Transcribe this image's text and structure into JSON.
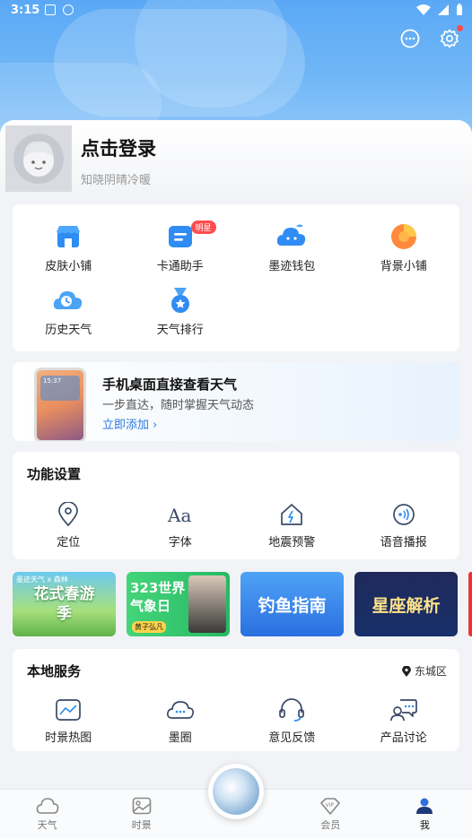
{
  "status_bar": {
    "time": "3:15"
  },
  "profile": {
    "title": "点击登录",
    "subtitle": "知晓阴晴冷暖"
  },
  "quick_grid": [
    {
      "label": "皮肤小铺",
      "icon": "shop-icon"
    },
    {
      "label": "卡通助手",
      "icon": "cartoon-assistant-icon",
      "badge": "明星"
    },
    {
      "label": "墨迹钱包",
      "icon": "wallet-icon"
    },
    {
      "label": "背景小铺",
      "icon": "background-shop-icon"
    },
    {
      "label": "历史天气",
      "icon": "history-weather-icon"
    },
    {
      "label": "天气排行",
      "icon": "ranking-medal-icon"
    }
  ],
  "promo": {
    "title": "手机桌面直接查看天气",
    "subtitle": "一步直达，随时掌握天气动态",
    "link": "立即添加 ›",
    "phone_time": "15:37"
  },
  "function_settings": {
    "title": "功能设置",
    "items": [
      {
        "label": "定位",
        "icon": "location-pin-icon"
      },
      {
        "label": "字体",
        "icon": "font-icon"
      },
      {
        "label": "地震预警",
        "icon": "earthquake-alert-icon"
      },
      {
        "label": "语音播报",
        "icon": "voice-broadcast-icon"
      }
    ]
  },
  "banners": [
    {
      "text": "花式春游季",
      "tag": "墨迹天气 x 森林"
    },
    {
      "text": "323世界气象日",
      "tag": "黄子弘凡"
    },
    {
      "text": "钓鱼指南",
      "tag": ""
    },
    {
      "text": "星座解析",
      "tag": ""
    }
  ],
  "local_services": {
    "title": "本地服务",
    "location": "东城区",
    "items": [
      {
        "label": "时景热图",
        "icon": "scene-heatmap-icon"
      },
      {
        "label": "墨圈",
        "icon": "community-cloud-icon"
      },
      {
        "label": "意见反馈",
        "icon": "headset-feedback-icon"
      },
      {
        "label": "产品讨论",
        "icon": "discussion-icon"
      }
    ]
  },
  "tabbar": [
    {
      "label": "天气",
      "icon": "weather-cloud-icon",
      "active": false
    },
    {
      "label": "时景",
      "icon": "scene-image-icon",
      "active": false
    },
    {
      "label": "",
      "icon": "center-weather-bubble",
      "active": false
    },
    {
      "label": "会员",
      "icon": "vip-icon",
      "active": false
    },
    {
      "label": "我",
      "icon": "me-person-icon",
      "active": true
    }
  ],
  "colors": {
    "accent": "#2a7ae2",
    "badge_red": "#ff4d4f",
    "hero_top": "#5aa8f5"
  }
}
